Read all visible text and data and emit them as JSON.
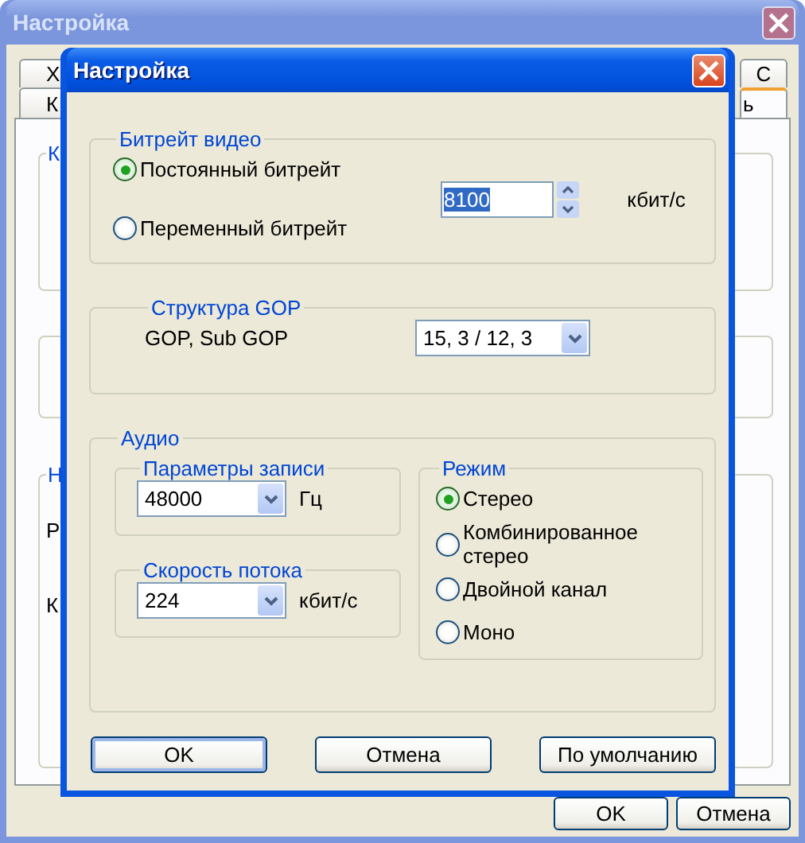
{
  "background_window": {
    "title": "Настройка",
    "active": false,
    "tab_rows": [
      [
        {
          "label": "Х",
          "selected": false
        },
        {
          "label": "С",
          "selected": false
        }
      ],
      [
        {
          "label": "К",
          "selected": false
        },
        {
          "label": "ь",
          "selected": true
        }
      ]
    ],
    "groups": [
      {
        "kind": "labeled",
        "label": "К"
      },
      {
        "kind": "plain"
      },
      {
        "kind": "labeled",
        "label": "Н",
        "texts": [
          "Р",
          "К"
        ]
      }
    ],
    "buttons": [
      {
        "label": "OK",
        "default": false
      },
      {
        "label": "Отмена",
        "default": false
      }
    ]
  },
  "dialog": {
    "title": "Настройка",
    "active": true,
    "video_bitrate": {
      "label": "Битрейт видео",
      "options": [
        {
          "label": "Постоянный битрейт",
          "selected": true
        },
        {
          "label": "Переменный битрейт",
          "selected": false
        }
      ],
      "value": "8100",
      "value_highlighted": true,
      "unit": "кбит/с"
    },
    "gop": {
      "label": "Структура GOP",
      "field_label": "GOP, Sub GOP",
      "value": "15, 3 / 12, 3"
    },
    "audio": {
      "label": "Аудио",
      "sampling": {
        "label": "Параметры записи",
        "value": "48000",
        "unit": "Гц"
      },
      "bitrate": {
        "label": "Скорость потока",
        "value": "224",
        "unit": "кбит/с"
      },
      "mode": {
        "label": "Режим",
        "options": [
          {
            "label": "Стерео",
            "selected": true
          },
          {
            "label": "Комбинированное стерео",
            "selected": false
          },
          {
            "label": "Двойной канал",
            "selected": false
          },
          {
            "label": "Моно",
            "selected": false
          }
        ]
      }
    },
    "buttons": [
      {
        "label": "OK",
        "default": true
      },
      {
        "label": "Отмена",
        "default": false
      },
      {
        "label": "По умолчанию",
        "default": false
      }
    ]
  }
}
